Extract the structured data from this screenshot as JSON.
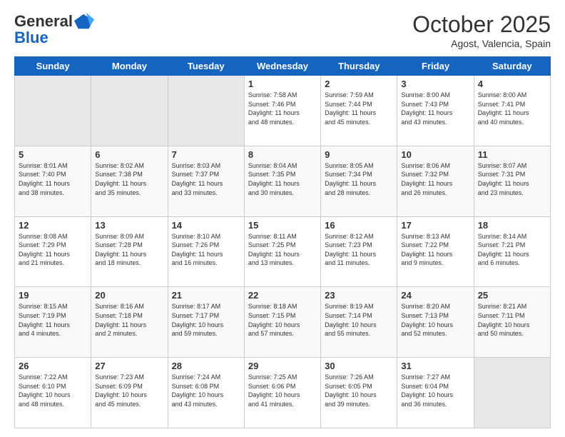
{
  "header": {
    "logo_line1": "General",
    "logo_line2": "Blue",
    "month": "October 2025",
    "location": "Agost, Valencia, Spain"
  },
  "days_of_week": [
    "Sunday",
    "Monday",
    "Tuesday",
    "Wednesday",
    "Thursday",
    "Friday",
    "Saturday"
  ],
  "weeks": [
    [
      {
        "day": "",
        "info": ""
      },
      {
        "day": "",
        "info": ""
      },
      {
        "day": "",
        "info": ""
      },
      {
        "day": "1",
        "info": "Sunrise: 7:58 AM\nSunset: 7:46 PM\nDaylight: 11 hours\nand 48 minutes."
      },
      {
        "day": "2",
        "info": "Sunrise: 7:59 AM\nSunset: 7:44 PM\nDaylight: 11 hours\nand 45 minutes."
      },
      {
        "day": "3",
        "info": "Sunrise: 8:00 AM\nSunset: 7:43 PM\nDaylight: 11 hours\nand 43 minutes."
      },
      {
        "day": "4",
        "info": "Sunrise: 8:00 AM\nSunset: 7:41 PM\nDaylight: 11 hours\nand 40 minutes."
      }
    ],
    [
      {
        "day": "5",
        "info": "Sunrise: 8:01 AM\nSunset: 7:40 PM\nDaylight: 11 hours\nand 38 minutes."
      },
      {
        "day": "6",
        "info": "Sunrise: 8:02 AM\nSunset: 7:38 PM\nDaylight: 11 hours\nand 35 minutes."
      },
      {
        "day": "7",
        "info": "Sunrise: 8:03 AM\nSunset: 7:37 PM\nDaylight: 11 hours\nand 33 minutes."
      },
      {
        "day": "8",
        "info": "Sunrise: 8:04 AM\nSunset: 7:35 PM\nDaylight: 11 hours\nand 30 minutes."
      },
      {
        "day": "9",
        "info": "Sunrise: 8:05 AM\nSunset: 7:34 PM\nDaylight: 11 hours\nand 28 minutes."
      },
      {
        "day": "10",
        "info": "Sunrise: 8:06 AM\nSunset: 7:32 PM\nDaylight: 11 hours\nand 26 minutes."
      },
      {
        "day": "11",
        "info": "Sunrise: 8:07 AM\nSunset: 7:31 PM\nDaylight: 11 hours\nand 23 minutes."
      }
    ],
    [
      {
        "day": "12",
        "info": "Sunrise: 8:08 AM\nSunset: 7:29 PM\nDaylight: 11 hours\nand 21 minutes."
      },
      {
        "day": "13",
        "info": "Sunrise: 8:09 AM\nSunset: 7:28 PM\nDaylight: 11 hours\nand 18 minutes."
      },
      {
        "day": "14",
        "info": "Sunrise: 8:10 AM\nSunset: 7:26 PM\nDaylight: 11 hours\nand 16 minutes."
      },
      {
        "day": "15",
        "info": "Sunrise: 8:11 AM\nSunset: 7:25 PM\nDaylight: 11 hours\nand 13 minutes."
      },
      {
        "day": "16",
        "info": "Sunrise: 8:12 AM\nSunset: 7:23 PM\nDaylight: 11 hours\nand 11 minutes."
      },
      {
        "day": "17",
        "info": "Sunrise: 8:13 AM\nSunset: 7:22 PM\nDaylight: 11 hours\nand 9 minutes."
      },
      {
        "day": "18",
        "info": "Sunrise: 8:14 AM\nSunset: 7:21 PM\nDaylight: 11 hours\nand 6 minutes."
      }
    ],
    [
      {
        "day": "19",
        "info": "Sunrise: 8:15 AM\nSunset: 7:19 PM\nDaylight: 11 hours\nand 4 minutes."
      },
      {
        "day": "20",
        "info": "Sunrise: 8:16 AM\nSunset: 7:18 PM\nDaylight: 11 hours\nand 2 minutes."
      },
      {
        "day": "21",
        "info": "Sunrise: 8:17 AM\nSunset: 7:17 PM\nDaylight: 10 hours\nand 59 minutes."
      },
      {
        "day": "22",
        "info": "Sunrise: 8:18 AM\nSunset: 7:15 PM\nDaylight: 10 hours\nand 57 minutes."
      },
      {
        "day": "23",
        "info": "Sunrise: 8:19 AM\nSunset: 7:14 PM\nDaylight: 10 hours\nand 55 minutes."
      },
      {
        "day": "24",
        "info": "Sunrise: 8:20 AM\nSunset: 7:13 PM\nDaylight: 10 hours\nand 52 minutes."
      },
      {
        "day": "25",
        "info": "Sunrise: 8:21 AM\nSunset: 7:11 PM\nDaylight: 10 hours\nand 50 minutes."
      }
    ],
    [
      {
        "day": "26",
        "info": "Sunrise: 7:22 AM\nSunset: 6:10 PM\nDaylight: 10 hours\nand 48 minutes."
      },
      {
        "day": "27",
        "info": "Sunrise: 7:23 AM\nSunset: 6:09 PM\nDaylight: 10 hours\nand 45 minutes."
      },
      {
        "day": "28",
        "info": "Sunrise: 7:24 AM\nSunset: 6:08 PM\nDaylight: 10 hours\nand 43 minutes."
      },
      {
        "day": "29",
        "info": "Sunrise: 7:25 AM\nSunset: 6:06 PM\nDaylight: 10 hours\nand 41 minutes."
      },
      {
        "day": "30",
        "info": "Sunrise: 7:26 AM\nSunset: 6:05 PM\nDaylight: 10 hours\nand 39 minutes."
      },
      {
        "day": "31",
        "info": "Sunrise: 7:27 AM\nSunset: 6:04 PM\nDaylight: 10 hours\nand 36 minutes."
      },
      {
        "day": "",
        "info": ""
      }
    ]
  ]
}
